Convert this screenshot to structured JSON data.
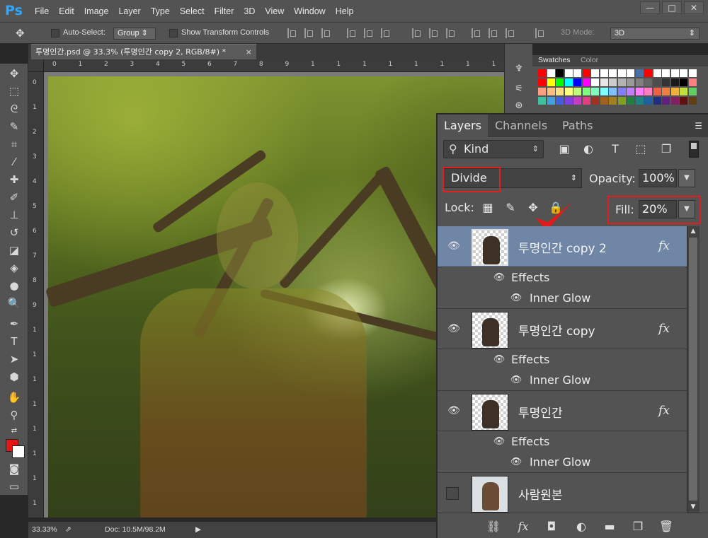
{
  "app": {
    "logo": "Ps"
  },
  "menu": [
    "File",
    "Edit",
    "Image",
    "Layer",
    "Type",
    "Select",
    "Filter",
    "3D",
    "View",
    "Window",
    "Help"
  ],
  "window_controls": {
    "minimize": "—",
    "restore": "□",
    "close": "✕"
  },
  "options_bar": {
    "auto_select_label": "Auto-Select:",
    "auto_select_value": "Group",
    "show_transform_label": "Show Transform Controls",
    "mode_3d_label": "3D Mode:",
    "mode_3d_value": "3D"
  },
  "document": {
    "tab_title": "투명인간.psd @ 33.3% (투명인간 copy 2, RGB/8#) *",
    "close": "×"
  },
  "ruler_h_labels": [
    "0",
    "1",
    "2",
    "3",
    "4",
    "5",
    "6",
    "7",
    "8",
    "9",
    "1",
    "1",
    "1",
    "1",
    "1",
    "1",
    "1",
    "1"
  ],
  "ruler_v_labels": [
    "0",
    "1",
    "2",
    "3",
    "4",
    "5",
    "6",
    "7",
    "8",
    "9",
    "1",
    "1",
    "1",
    "1",
    "1",
    "1",
    "1",
    "1"
  ],
  "status": {
    "zoom": "33.33%",
    "doc_info": "Doc: 10.5M/98.2M"
  },
  "swatches_panel": {
    "tabs": [
      "Swatches",
      "Color"
    ]
  },
  "layers_panel": {
    "tabs": [
      "Layers",
      "Channels",
      "Paths"
    ],
    "kind": "Kind",
    "blend_mode": "Divide",
    "opacity_label": "Opacity:",
    "opacity_value": "100%",
    "lock_label": "Lock:",
    "fill_label": "Fill:",
    "fill_value": "20%",
    "layers": [
      {
        "name": "투명인간 copy 2",
        "fx": "fx",
        "effects_label": "Effects",
        "effect": "Inner Glow",
        "selected": true
      },
      {
        "name": "투명인간 copy",
        "fx": "fx",
        "effects_label": "Effects",
        "effect": "Inner Glow",
        "selected": false
      },
      {
        "name": "투명인간",
        "fx": "fx",
        "effects_label": "Effects",
        "effect": "Inner Glow",
        "selected": false
      },
      {
        "name": "사람원본",
        "selected": false
      }
    ]
  },
  "colors": {
    "highlight_box": "#e21f1f",
    "selected_layer": "#6f86a6",
    "foreground": "#e51616",
    "background": "#ffffff"
  }
}
